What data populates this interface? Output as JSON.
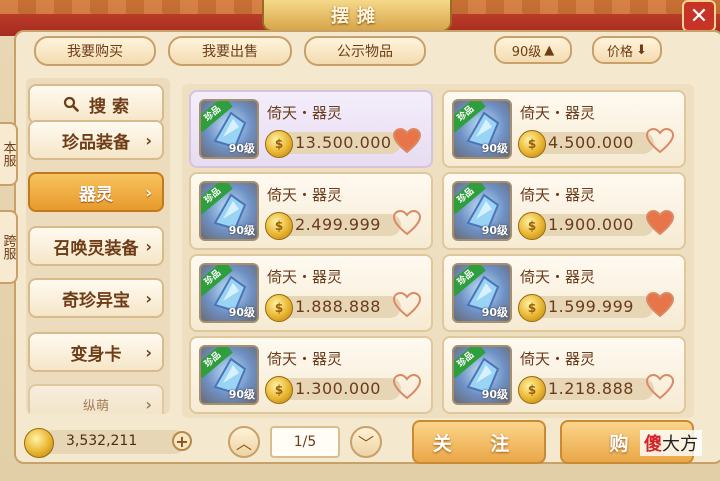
{
  "header": {
    "title": "摆摊",
    "close_icon": "close-icon"
  },
  "tabs": {
    "buy": "我要购买",
    "sell": "我要出售",
    "public": "公示物品"
  },
  "sort": {
    "level": "90级",
    "level_arrow": "▲",
    "price": "价格",
    "price_arrow": "⬇"
  },
  "side_tabs": {
    "top": "本服",
    "bottom": "跨服"
  },
  "categories": [
    {
      "label": "搜 索",
      "icon": "search-icon"
    },
    {
      "label": "珍品装备"
    },
    {
      "label": "器灵"
    },
    {
      "label": "召唤灵装备"
    },
    {
      "label": "奇珍异宝"
    },
    {
      "label": "变身卡"
    },
    {
      "label": "纵萌"
    }
  ],
  "items": [
    {
      "badge": "珍品",
      "level": "90级",
      "name": "倚天・器灵",
      "price": "13.500.000",
      "favorited": true
    },
    {
      "badge": "珍品",
      "level": "90级",
      "name": "倚天・器灵",
      "price": "4.500.000",
      "favorited": false
    },
    {
      "badge": "珍品",
      "level": "90级",
      "name": "倚天・器灵",
      "price": "2.499.999",
      "favorited": false
    },
    {
      "badge": "珍品",
      "level": "90级",
      "name": "倚天・器灵",
      "price": "1.900.000",
      "favorited": true
    },
    {
      "badge": "珍品",
      "level": "90级",
      "name": "倚天・器灵",
      "price": "1.888.888",
      "favorited": false
    },
    {
      "badge": "珍品",
      "level": "90级",
      "name": "倚天・器灵",
      "price": "1.599.999",
      "favorited": true
    },
    {
      "badge": "珍品",
      "level": "90级",
      "name": "倚天・器灵",
      "price": "1.300.000",
      "favorited": false
    },
    {
      "badge": "珍品",
      "level": "90级",
      "name": "倚天・器灵",
      "price": "1.218.888",
      "favorited": false
    }
  ],
  "footer": {
    "balance": "3,532,211",
    "plus": "+",
    "page": "1/5",
    "follow_label": "关 注",
    "buy_label": "购"
  },
  "watermark": {
    "red": "傻",
    "black": "大方"
  },
  "colors": {
    "accent": "#e79a2c",
    "heart": "#e8744a",
    "ribbon": "#2f9e3c"
  }
}
